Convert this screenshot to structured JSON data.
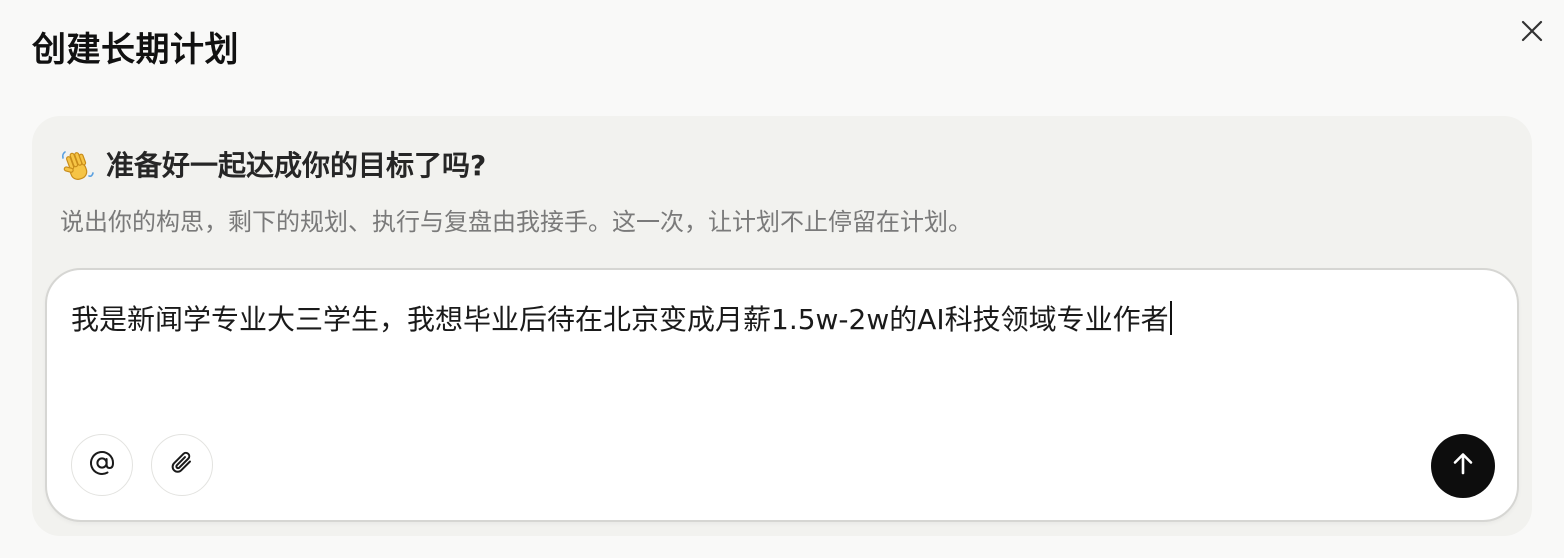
{
  "dialog": {
    "title": "创建长期计划",
    "close_icon": "close-icon"
  },
  "panel": {
    "greeting_icon": "waving-hand-icon",
    "greeting": "准备好一起达成你的目标了吗?",
    "subtitle": "说出你的构思，剩下的规划、执行与复盘由我接手。这一次，让计划不止停留在计划。"
  },
  "composer": {
    "value": "我是新闻学专业大三学生，我想毕业后待在北京变成月薪1.5w-2w的AI科技领域专业作者",
    "mention_icon": "at-sign-icon",
    "attach_icon": "paperclip-icon",
    "send_icon": "arrow-up-icon"
  },
  "colors": {
    "background": "#f9f9f8",
    "panel": "#f2f2ef",
    "send_button": "#0d0d0d",
    "subtitle_text": "#7a7a7a"
  }
}
